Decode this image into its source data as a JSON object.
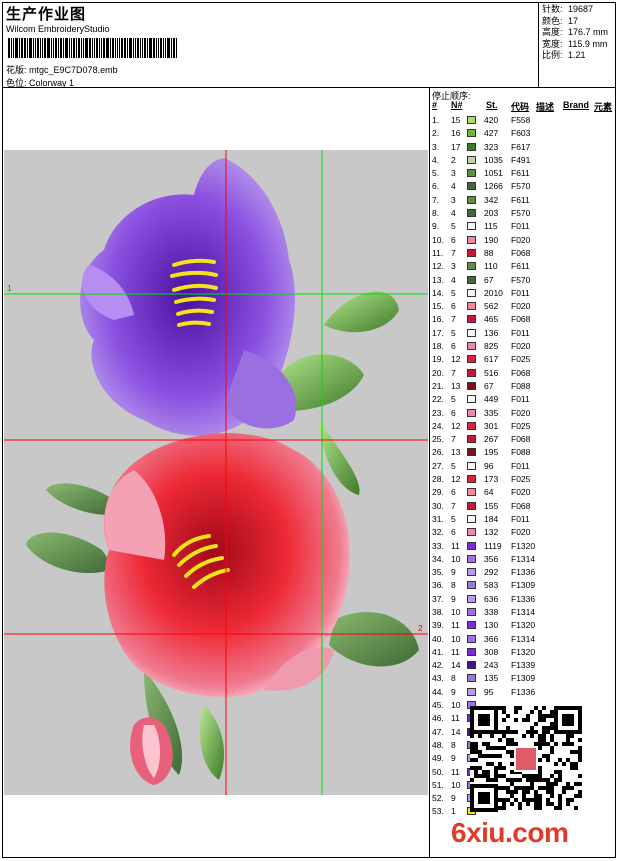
{
  "header": {
    "title": "生产作业图",
    "software": "Wilcom EmbroideryStudio",
    "design_label": "花版:",
    "design_name": "mtgc_E9C7D078.emb",
    "colorway_label": "色位:",
    "colorway_name": "Colorway 1"
  },
  "stats": [
    {
      "label": "针数:",
      "value": "19687"
    },
    {
      "label": "颜色:",
      "value": "17"
    },
    {
      "label": "高度:",
      "value": "176.7 mm"
    },
    {
      "label": "宽度:",
      "value": "115.9 mm"
    },
    {
      "label": "比例:",
      "value": "1.21"
    }
  ],
  "sequence": {
    "title": "停止顺序:",
    "headers": {
      "num": "#",
      "n": "N#",
      "st": "St.",
      "code": "代码",
      "desc": "描述",
      "brand": "Brand",
      "elem": "元素"
    },
    "rows": [
      {
        "n": "1.",
        "c": "15",
        "st": "420",
        "code": "F558",
        "color": "#a6e06a"
      },
      {
        "n": "2.",
        "c": "16",
        "st": "427",
        "code": "F603",
        "color": "#6bb83a"
      },
      {
        "n": "3.",
        "c": "17",
        "st": "323",
        "code": "F617",
        "color": "#3f7a2a"
      },
      {
        "n": "4.",
        "c": "2",
        "st": "1035",
        "code": "F491",
        "color": "#b9d6a0"
      },
      {
        "n": "5.",
        "c": "3",
        "st": "1051",
        "code": "F611",
        "color": "#5f8e46"
      },
      {
        "n": "6.",
        "c": "4",
        "st": "1266",
        "code": "F570",
        "color": "#3f6a35"
      },
      {
        "n": "7.",
        "c": "3",
        "st": "342",
        "code": "F611",
        "color": "#5f8e46"
      },
      {
        "n": "8.",
        "c": "4",
        "st": "203",
        "code": "F570",
        "color": "#3f6a35"
      },
      {
        "n": "9.",
        "c": "5",
        "st": "115",
        "code": "F011",
        "color": "#fdf6f6"
      },
      {
        "n": "10.",
        "c": "6",
        "st": "190",
        "code": "F020",
        "color": "#f08aa0"
      },
      {
        "n": "11.",
        "c": "7",
        "st": "88",
        "code": "F068",
        "color": "#c8183a"
      },
      {
        "n": "12.",
        "c": "3",
        "st": "110",
        "code": "F611",
        "color": "#5f8e46"
      },
      {
        "n": "13.",
        "c": "4",
        "st": "67",
        "code": "F570",
        "color": "#3f6a35"
      },
      {
        "n": "14.",
        "c": "5",
        "st": "2010",
        "code": "F011",
        "color": "#fdf6f6"
      },
      {
        "n": "15.",
        "c": "6",
        "st": "562",
        "code": "F020",
        "color": "#f08aa0"
      },
      {
        "n": "16.",
        "c": "7",
        "st": "465",
        "code": "F068",
        "color": "#c8183a"
      },
      {
        "n": "17.",
        "c": "5",
        "st": "136",
        "code": "F011",
        "color": "#fdf6f6"
      },
      {
        "n": "18.",
        "c": "6",
        "st": "825",
        "code": "F020",
        "color": "#f08aa0"
      },
      {
        "n": "19.",
        "c": "12",
        "st": "617",
        "code": "F025",
        "color": "#e0203a"
      },
      {
        "n": "20.",
        "c": "7",
        "st": "516",
        "code": "F068",
        "color": "#c8183a"
      },
      {
        "n": "21.",
        "c": "13",
        "st": "67",
        "code": "F088",
        "color": "#7a1020"
      },
      {
        "n": "22.",
        "c": "5",
        "st": "449",
        "code": "F011",
        "color": "#fdf6f6"
      },
      {
        "n": "23.",
        "c": "6",
        "st": "335",
        "code": "F020",
        "color": "#f08aa0"
      },
      {
        "n": "24.",
        "c": "12",
        "st": "301",
        "code": "F025",
        "color": "#e0203a"
      },
      {
        "n": "25.",
        "c": "7",
        "st": "267",
        "code": "F068",
        "color": "#c8183a"
      },
      {
        "n": "26.",
        "c": "13",
        "st": "195",
        "code": "F088",
        "color": "#7a1020"
      },
      {
        "n": "27.",
        "c": "5",
        "st": "96",
        "code": "F011",
        "color": "#fdf6f6"
      },
      {
        "n": "28.",
        "c": "12",
        "st": "173",
        "code": "F025",
        "color": "#e0203a"
      },
      {
        "n": "29.",
        "c": "6",
        "st": "64",
        "code": "F020",
        "color": "#f08aa0"
      },
      {
        "n": "30.",
        "c": "7",
        "st": "155",
        "code": "F068",
        "color": "#c8183a"
      },
      {
        "n": "31.",
        "c": "5",
        "st": "184",
        "code": "F011",
        "color": "#fdf6f6"
      },
      {
        "n": "32.",
        "c": "6",
        "st": "132",
        "code": "F020",
        "color": "#f08aa0"
      },
      {
        "n": "33.",
        "c": "11",
        "st": "1119",
        "code": "F1320",
        "color": "#7a2ad8"
      },
      {
        "n": "34.",
        "c": "10",
        "st": "356",
        "code": "F1314",
        "color": "#a070e8"
      },
      {
        "n": "35.",
        "c": "9",
        "st": "292",
        "code": "F1336",
        "color": "#b898f0"
      },
      {
        "n": "36.",
        "c": "8",
        "st": "583",
        "code": "F1309",
        "color": "#9a7ad8"
      },
      {
        "n": "37.",
        "c": "9",
        "st": "636",
        "code": "F1336",
        "color": "#b898f0"
      },
      {
        "n": "38.",
        "c": "10",
        "st": "338",
        "code": "F1314",
        "color": "#a070e8"
      },
      {
        "n": "39.",
        "c": "11",
        "st": "130",
        "code": "F1320",
        "color": "#7a2ad8"
      },
      {
        "n": "40.",
        "c": "10",
        "st": "366",
        "code": "F1314",
        "color": "#a070e8"
      },
      {
        "n": "41.",
        "c": "11",
        "st": "308",
        "code": "F1320",
        "color": "#7a2ad8"
      },
      {
        "n": "42.",
        "c": "14",
        "st": "243",
        "code": "F1339",
        "color": "#4a1090"
      },
      {
        "n": "43.",
        "c": "8",
        "st": "135",
        "code": "F1309",
        "color": "#9a7ad8"
      },
      {
        "n": "44.",
        "c": "9",
        "st": "95",
        "code": "F1336",
        "color": "#b898f0"
      },
      {
        "n": "45.",
        "c": "10",
        "st": "",
        "code": "",
        "color": "#a070e8"
      },
      {
        "n": "46.",
        "c": "11",
        "st": "",
        "code": "",
        "color": "#7a2ad8"
      },
      {
        "n": "47.",
        "c": "14",
        "st": "",
        "code": "",
        "color": "#4a1090"
      },
      {
        "n": "48.",
        "c": "8",
        "st": "",
        "code": "",
        "color": "#9a7ad8"
      },
      {
        "n": "49.",
        "c": "9",
        "st": "",
        "code": "",
        "color": "#b898f0"
      },
      {
        "n": "50.",
        "c": "11",
        "st": "",
        "code": "",
        "color": "#7a2ad8"
      },
      {
        "n": "51.",
        "c": "10",
        "st": "",
        "code": "",
        "color": "#a070e8"
      },
      {
        "n": "52.",
        "c": "9",
        "st": "",
        "code": "",
        "color": "#b898f0"
      },
      {
        "n": "53.",
        "c": "1",
        "st": "",
        "code": "",
        "color": "#f4e21a"
      }
    ]
  },
  "guides": {
    "h1_label": "1",
    "h2_label": "2"
  },
  "watermark": "6xiu.com",
  "colors": {
    "guide_red": "#ff0000",
    "guide_green": "#00e000",
    "canvas_bg": "#c8c8c8"
  }
}
